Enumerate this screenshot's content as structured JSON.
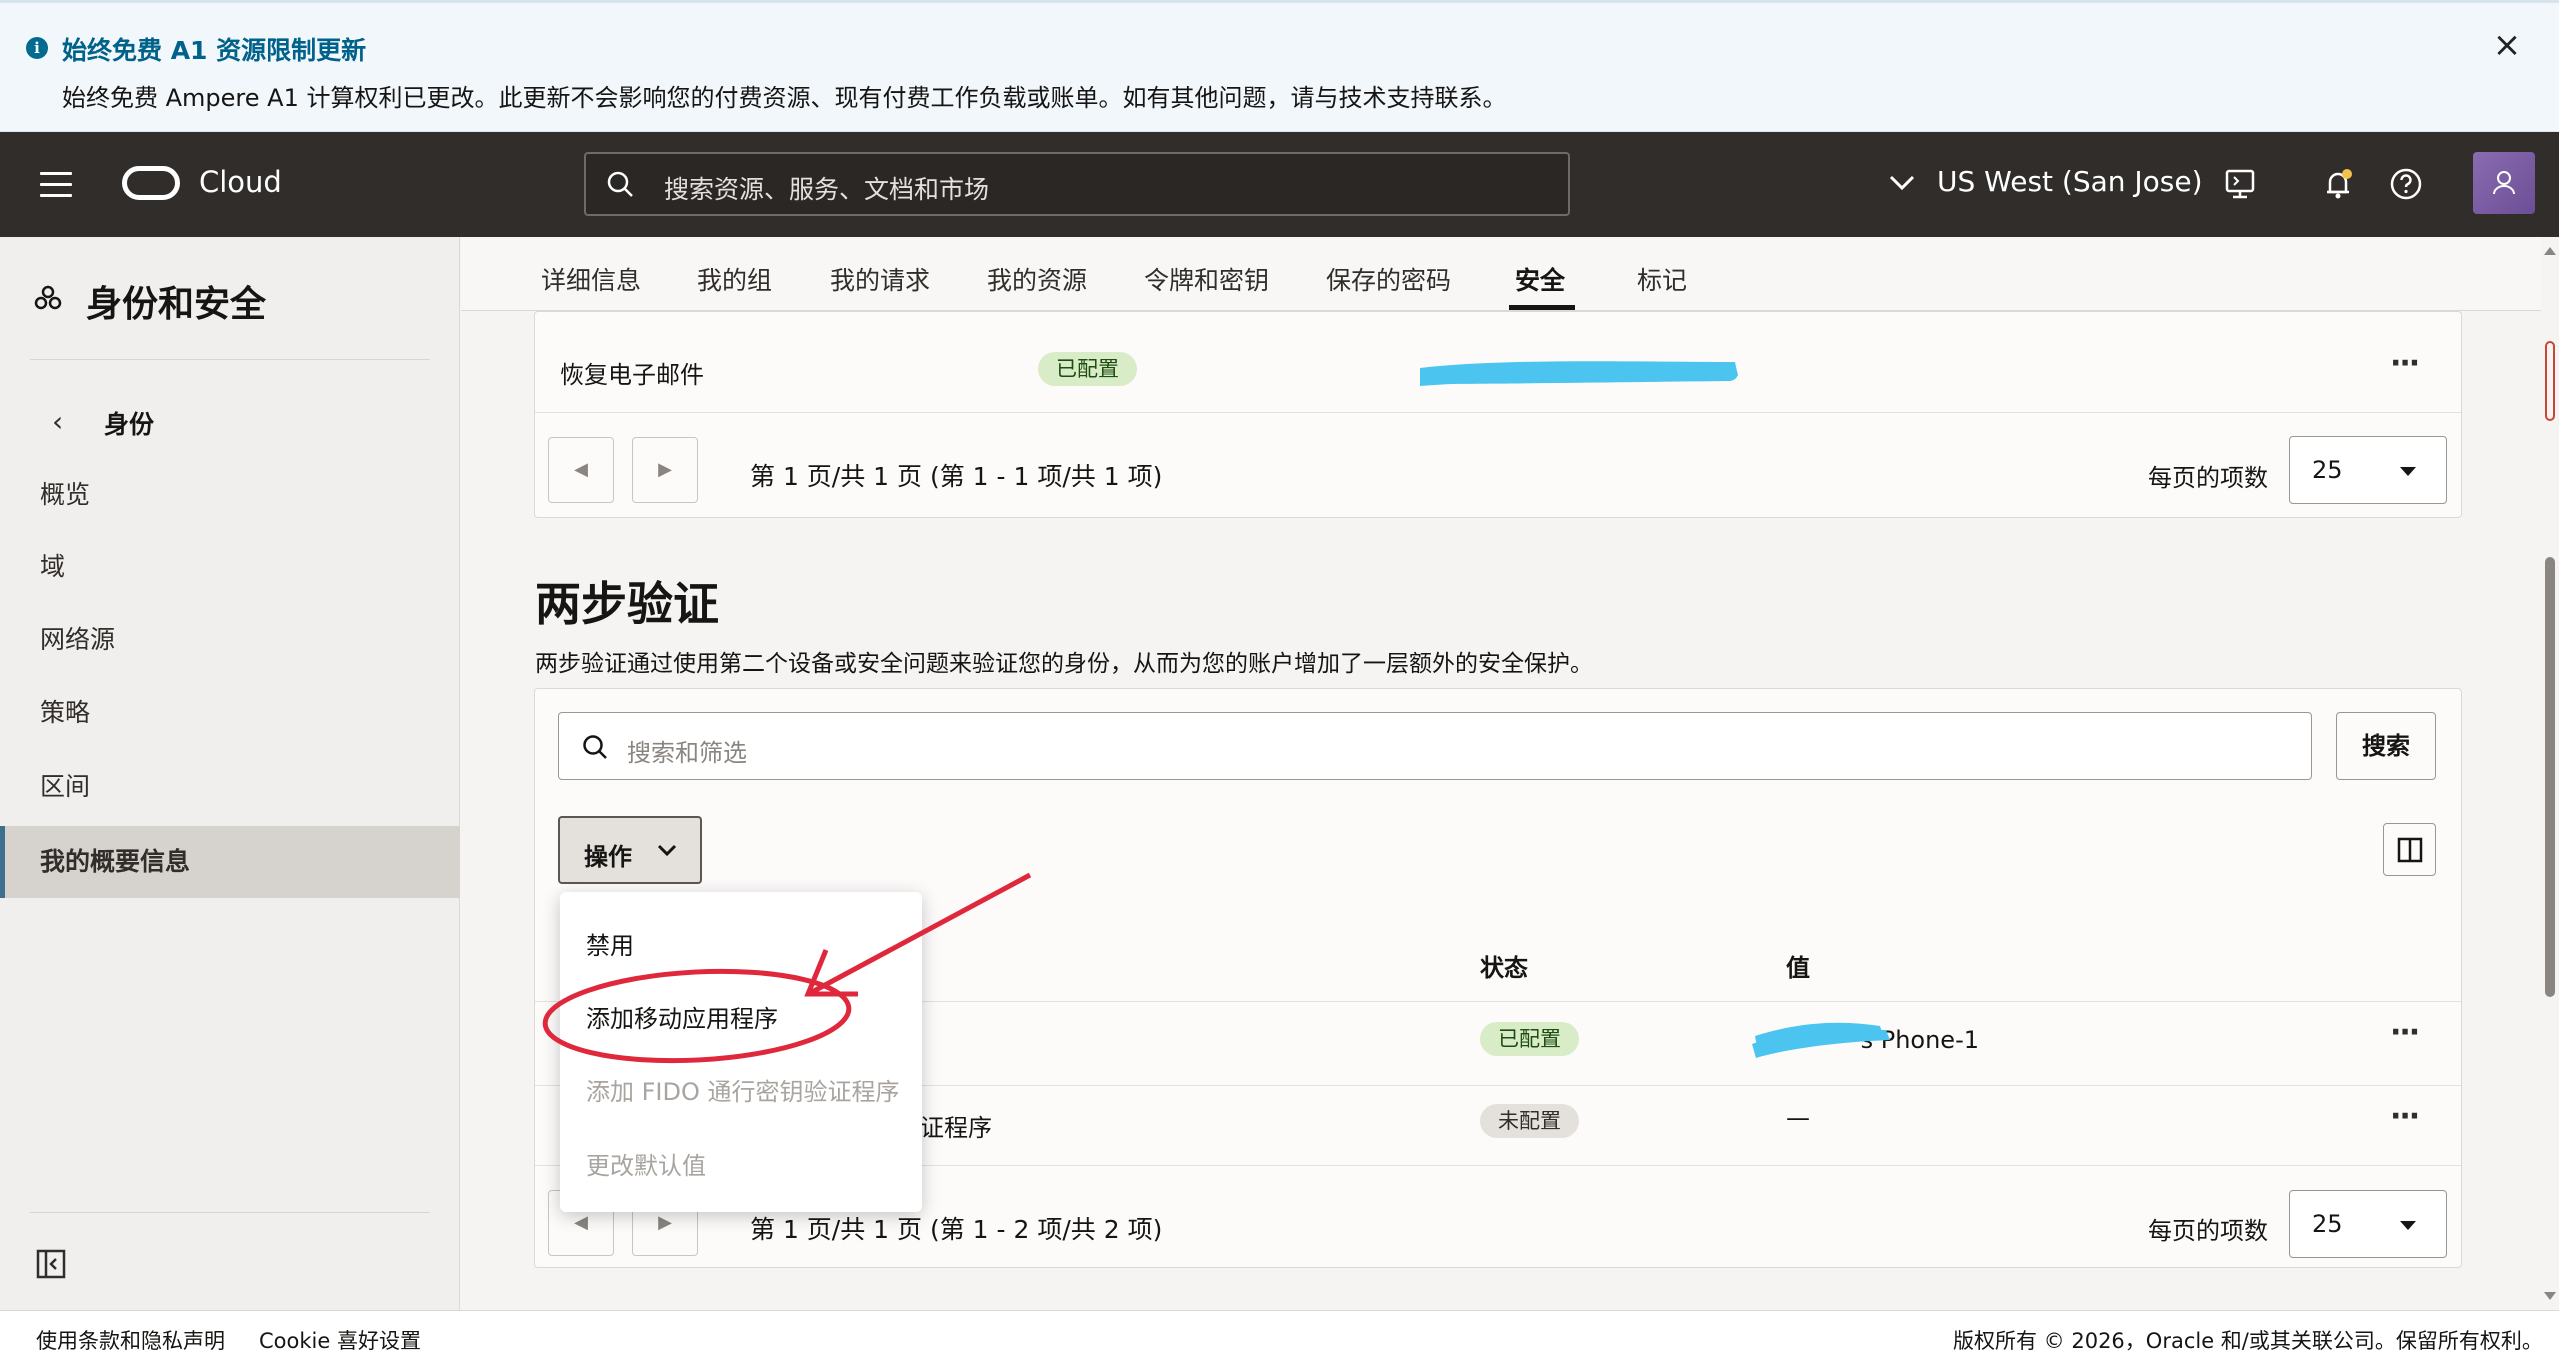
{
  "banner": {
    "title": "始终免费 A1 资源限制更新",
    "message": "始终免费 Ampere A1 计算权利已更改。此更新不会影响您的付费资源、现有付费工作负载或账单。如有其他问题，请与技术支持联系。",
    "close": "×"
  },
  "header": {
    "brand": "Cloud",
    "search_placeholder": "搜索资源、服务、文档和市场",
    "region": "US West (San Jose)"
  },
  "sidebar": {
    "title": "身份和安全",
    "parent": "身份",
    "items": [
      "概览",
      "域",
      "网络源",
      "策略",
      "区间",
      "我的概要信息"
    ],
    "active_index": 5
  },
  "tabs": [
    "详细信息",
    "我的组",
    "我的请求",
    "我的资源",
    "令牌和密钥",
    "保存的密码",
    "安全",
    "标记"
  ],
  "active_tab": "安全",
  "recovery": {
    "row_label": "恢复电子邮件",
    "status": "已配置",
    "pagination": "第 1 页/共 1 页 (第 1 - 1 项/共 1 项)",
    "per_page_label": "每页的项数",
    "per_page_value": "25"
  },
  "two_step": {
    "title": "两步验证",
    "description": "两步验证通过使用第二个设备或安全问题来验证您的身份，从而为您的账户增加了一层额外的安全保护。",
    "search_placeholder": "搜索和筛选",
    "search_button": "搜索",
    "actions_button": "操作",
    "columns": {
      "status": "状态",
      "value": "值"
    },
    "rows": [
      {
        "name_visible": "",
        "status": "已配置",
        "value": "'s Phone-1"
      },
      {
        "name_visible": "证程序",
        "status": "未配置",
        "value": "—"
      }
    ],
    "pagination": "第 1 页/共 1 页 (第 1 - 2 项/共 2 项)",
    "per_page_label": "每页的项数",
    "per_page_value": "25"
  },
  "actions_menu": {
    "items": [
      {
        "label": "禁用",
        "disabled": false
      },
      {
        "label": "添加移动应用程序",
        "disabled": false
      },
      {
        "label": "添加 FIDO 通行密钥验证程序",
        "disabled": true
      },
      {
        "label": "更改默认值",
        "disabled": true
      }
    ]
  },
  "footer": {
    "terms": "使用条款和隐私声明",
    "cookie": "Cookie 喜好设置",
    "copyright": "版权所有 © 2026，Oracle 和/或其关联公司。保留所有权利。"
  },
  "colors": {
    "header_bg": "#312d2a",
    "badge_green": "#d8ecc8",
    "annotation_red": "#e0283c",
    "redaction_blue": "#4cc4f0"
  },
  "icons": [
    "info-icon",
    "close-icon",
    "menu-icon",
    "oracle-logo",
    "search-icon",
    "chevron-down-icon",
    "cloud-shell-icon",
    "bell-icon",
    "help-icon",
    "avatar",
    "identity-icon",
    "chevron-left-icon",
    "collapse-sidebar-icon",
    "columns-icon",
    "more-actions-icon"
  ]
}
